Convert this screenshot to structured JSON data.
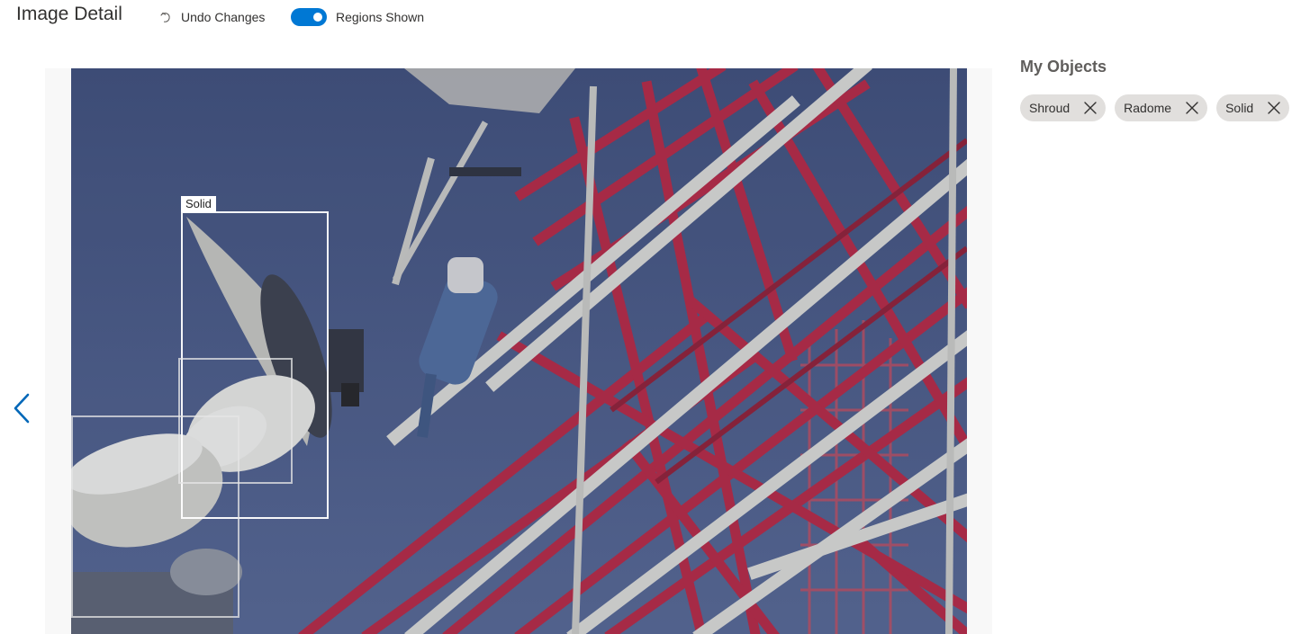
{
  "header": {
    "title": "Image Detail",
    "undo_label": "Undo Changes",
    "undo_icon": "undo-icon",
    "toggle_label": "Regions Shown",
    "toggle_on": true
  },
  "viewer": {
    "prev_icon": "chevron-left-icon",
    "regions": [
      {
        "label": "Solid",
        "label_visible": true
      },
      {
        "label": "Radome",
        "label_visible": false
      },
      {
        "label": "Shroud",
        "label_visible": false
      }
    ]
  },
  "sidebar": {
    "title": "My Objects",
    "objects": [
      {
        "label": "Shroud",
        "remove_icon": "close-icon"
      },
      {
        "label": "Radome",
        "remove_icon": "close-icon"
      },
      {
        "label": "Solid",
        "remove_icon": "close-icon"
      }
    ]
  },
  "colors": {
    "accent": "#0078d4",
    "chip_bg": "#e1dfdd",
    "sky": "#485a86",
    "tower_red": "#b0253e",
    "tower_white": "#d8d8d0"
  }
}
